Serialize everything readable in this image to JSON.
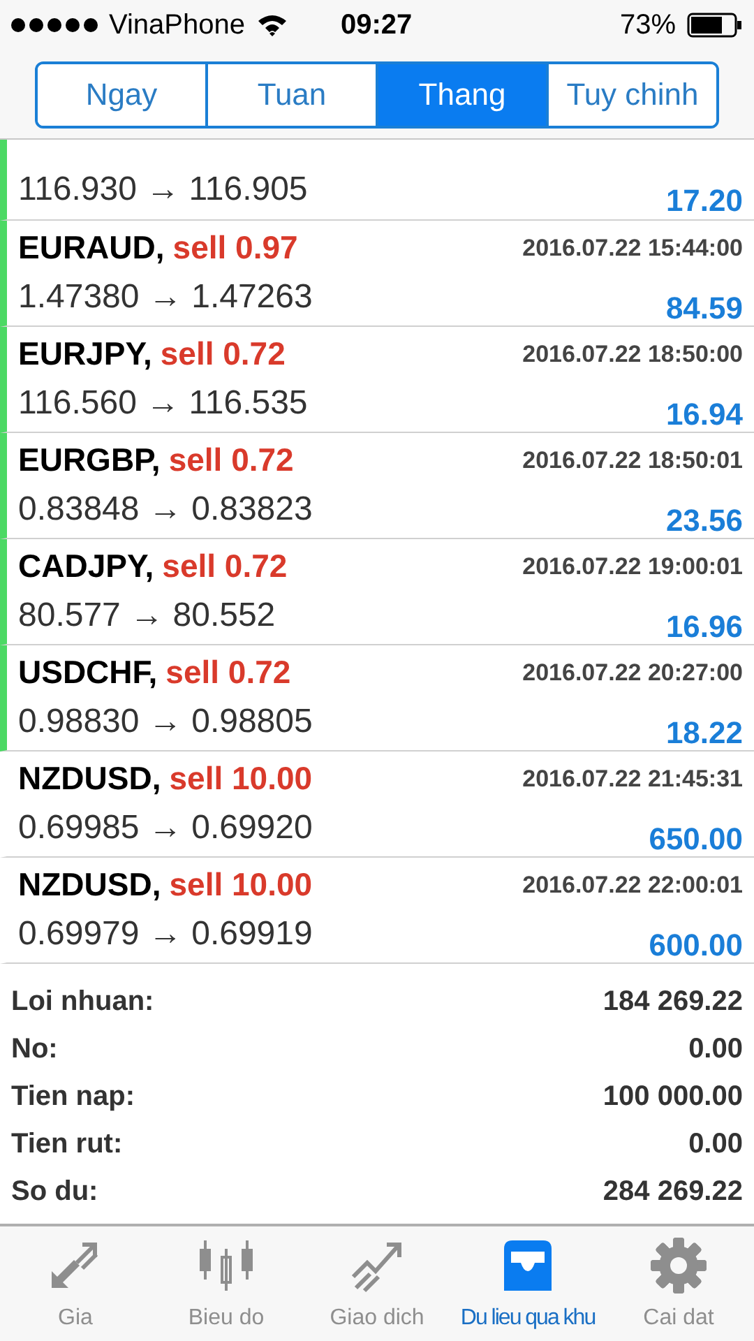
{
  "status_bar": {
    "carrier": "VinaPhone",
    "time": "09:27",
    "battery": "73%"
  },
  "tabs": [
    {
      "label": "Ngay",
      "selected": false
    },
    {
      "label": "Tuan",
      "selected": false
    },
    {
      "label": "Thang",
      "selected": true
    },
    {
      "label": "Tuy chinh",
      "selected": false
    }
  ],
  "trades": [
    {
      "prices": "116.930 → 116.905",
      "profit": "17.20",
      "marked": true
    },
    {
      "symbol": "EURAUD,",
      "side": "sell 0.97",
      "time": "2016.07.22 15:44:00",
      "prices": "1.47380 → 1.47263",
      "profit": "84.59",
      "marked": true
    },
    {
      "symbol": "EURJPY,",
      "side": "sell 0.72",
      "time": "2016.07.22 18:50:00",
      "prices": "116.560 → 116.535",
      "profit": "16.94",
      "marked": true
    },
    {
      "symbol": "EURGBP,",
      "side": "sell 0.72",
      "time": "2016.07.22 18:50:01",
      "prices": "0.83848 → 0.83823",
      "profit": "23.56",
      "marked": true
    },
    {
      "symbol": "CADJPY,",
      "side": "sell 0.72",
      "time": "2016.07.22 19:00:01",
      "prices": "80.577 → 80.552",
      "profit": "16.96",
      "marked": true
    },
    {
      "symbol": "USDCHF,",
      "side": "sell 0.72",
      "time": "2016.07.22 20:27:00",
      "prices": "0.98830 → 0.98805",
      "profit": "18.22",
      "marked": true
    },
    {
      "symbol": "NZDUSD,",
      "side": "sell 10.00",
      "time": "2016.07.22 21:45:31",
      "prices": "0.69985 → 0.69920",
      "profit": "650.00",
      "marked": false
    },
    {
      "symbol": "NZDUSD,",
      "side": "sell 10.00",
      "time": "2016.07.22 22:00:01",
      "prices": "0.69979 → 0.69919",
      "profit": "600.00",
      "marked": false
    }
  ],
  "summary": [
    {
      "label": "Loi nhuan:",
      "value": "184 269.22"
    },
    {
      "label": "No:",
      "value": "0.00"
    },
    {
      "label": "Tien nap:",
      "value": "100 000.00"
    },
    {
      "label": "Tien rut:",
      "value": "0.00"
    },
    {
      "label": "So du:",
      "value": "284 269.22"
    }
  ],
  "tab_bar": [
    {
      "kind": "price",
      "label": "Gia",
      "selected": false
    },
    {
      "kind": "chart",
      "label": "Bieu do",
      "selected": false
    },
    {
      "kind": "trade",
      "label": "Giao dich",
      "selected": false
    },
    {
      "kind": "history",
      "label": "Du lieu qua khu",
      "selected": true
    },
    {
      "kind": "settings",
      "label": "Cai dat",
      "selected": false
    }
  ]
}
